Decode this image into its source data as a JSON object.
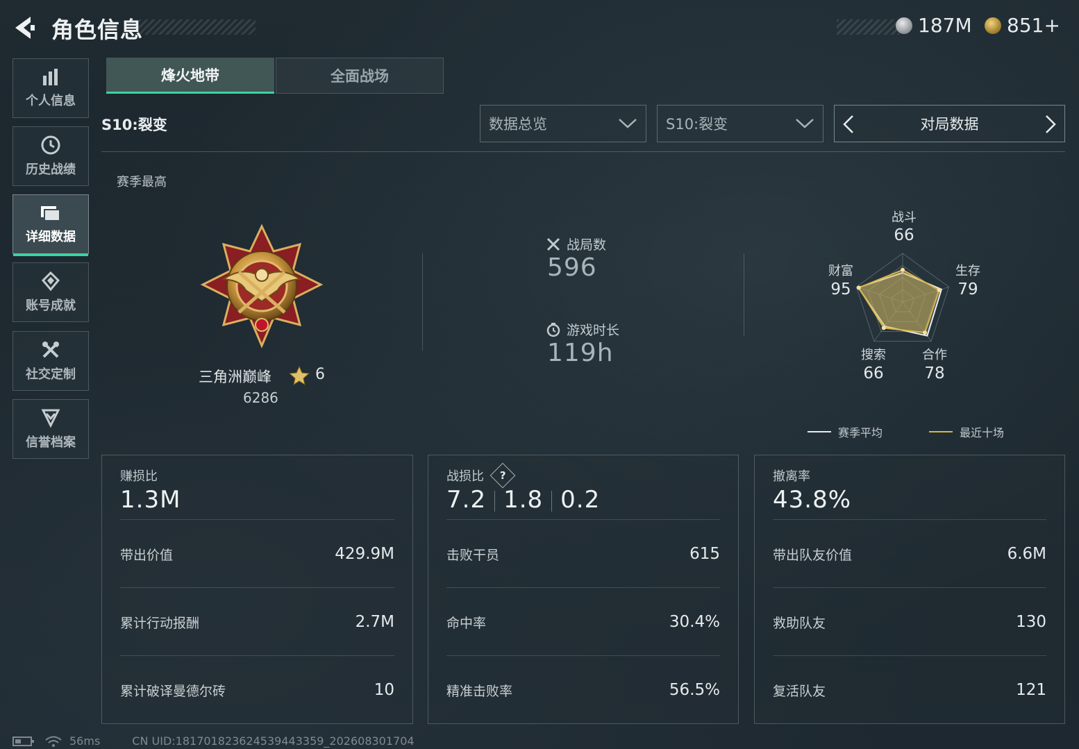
{
  "header": {
    "title": "角色信息",
    "currency1": "187M",
    "currency2": "851+"
  },
  "sidebar": {
    "items": [
      {
        "label": "个人信息",
        "icon": "bar-chart-icon"
      },
      {
        "label": "历史战绩",
        "icon": "history-clock-icon"
      },
      {
        "label": "详细数据",
        "icon": "folder-icon",
        "active": true
      },
      {
        "label": "账号成就",
        "icon": "achievement-icon"
      },
      {
        "label": "社交定制",
        "icon": "tools-icon"
      },
      {
        "label": "信誉档案",
        "icon": "shield-chevron-icon"
      }
    ]
  },
  "tabs": {
    "fenghuo": "烽火地带",
    "quanmian": "全面战场"
  },
  "filters": {
    "season_label": "S10:裂变",
    "overview": "数据总览",
    "season": "S10:裂变",
    "pager": "对局数据"
  },
  "best": {
    "label": "赛季最高",
    "rank_name": "三角洲巅峰",
    "stars": "6",
    "score": "6286"
  },
  "stats": {
    "matches_label": "战局数",
    "matches": "596",
    "time_label": "游戏时长",
    "time": "119h"
  },
  "radar": {
    "labels": {
      "combat": "战斗",
      "survival": "生存",
      "coop": "合作",
      "search": "搜索",
      "wealth": "财富"
    },
    "values": {
      "combat": "66",
      "survival": "79",
      "coop": "78",
      "search": "66",
      "wealth": "95"
    },
    "season_avg": [
      60,
      84,
      86,
      62,
      96
    ],
    "recent_ten": [
      66,
      79,
      78,
      66,
      95
    ],
    "legend_avg": "赛季平均",
    "legend_recent": "最近十场",
    "colors": {
      "avg": "#e8ecee",
      "recent": "#d8b64a"
    }
  },
  "cards": {
    "profit": {
      "title": "赚损比",
      "value": "1.3M",
      "rows": [
        {
          "k": "带出价值",
          "v": "429.9M"
        },
        {
          "k": "累计行动报酬",
          "v": "2.7M"
        },
        {
          "k": "累计破译曼德尔砖",
          "v": "10"
        }
      ]
    },
    "kd": {
      "title": "战损比",
      "help": "?",
      "v1": "7.2",
      "v2": "1.8",
      "v3": "0.2",
      "rows": [
        {
          "k": "击败干员",
          "v": "615"
        },
        {
          "k": "命中率",
          "v": "30.4%"
        },
        {
          "k": "精准击败率",
          "v": "56.5%"
        }
      ]
    },
    "extract": {
      "title": "撤离率",
      "value": "43.8%",
      "rows": [
        {
          "k": "带出队友价值",
          "v": "6.6M"
        },
        {
          "k": "救助队友",
          "v": "130"
        },
        {
          "k": "复活队友",
          "v": "121"
        }
      ]
    }
  },
  "footer": {
    "ping": "56ms",
    "uid": "CN UID:181701823624539443359_202608301704"
  },
  "colors": {
    "accent": "#3dd3a0",
    "gold": "#d8b64a"
  }
}
